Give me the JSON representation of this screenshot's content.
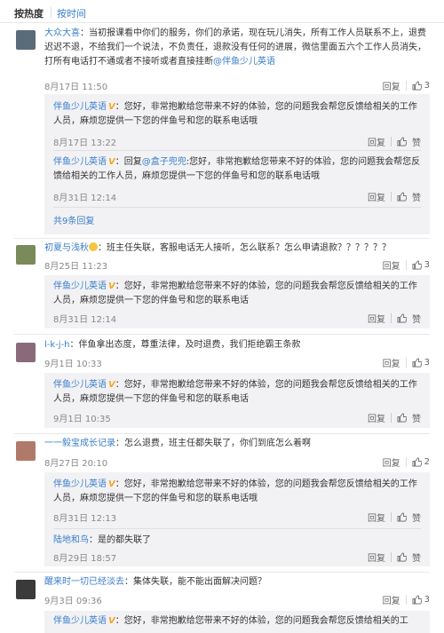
{
  "tabs": {
    "hot": "按热度",
    "time": "按时间"
  },
  "comments": [
    {
      "author": "大众大喜",
      "text": "：当初报课看中你们的服务，你们的承诺，现在玩儿消失，所有工作人员联系不上，退费迟迟不退，不给我们一个说法，不负责任，退款没有任何的进展，微信里面五六个工作人员消失，打所有电话打不通或者不接听或者直接挂断",
      "mention": "@伴鱼少儿英语",
      "time": "8月17日 11:50",
      "reply": "回复",
      "likes": "3",
      "avatar_color": "#5a6b7a",
      "replies": [
        {
          "author": "伴鱼少儿英语",
          "text": "：您好，非常抱歉给您带来不好的体验，您的问题我会帮您反馈给相关的工作人员，麻烦您提供一下您的伴鱼号和您的联系电话哦",
          "time": "8月17日 13:22",
          "reply": "回复",
          "like": "赞"
        },
        {
          "author": "伴鱼少儿英语",
          "prefix": "：回复",
          "mention": "@盒子兜兜",
          "text": ":您好，非常抱歉给您带来不好的体验，您的问题我会帮您反馈给相关的工作人员，麻烦您提供一下您的伴鱼号和您的联系电话哦",
          "time": "8月31日 12:14",
          "reply": "回复",
          "like": "赞"
        }
      ],
      "more": "共9条回复"
    },
    {
      "author": "初夏与浅秋",
      "text": "：班主任失联，客服电话无人接听，怎么联系？怎么申请退款？？？？？？",
      "time": "8月25日 11:23",
      "reply": "回复",
      "likes": "3",
      "avatar_color": "#7a8a5a",
      "replies": [
        {
          "author": "伴鱼少儿英语",
          "text": "：您好，非常抱歉给您带来不好的体验，您的问题我会帮您反馈给相关的工作人员，麻烦您提供一下您的伴鱼号和您的联系电话",
          "time": "8月31日 12:14",
          "reply": "回复",
          "like": "赞"
        }
      ]
    },
    {
      "author": "l-k-j-h",
      "text": "：伴鱼拿出态度，尊重法律，及时退费，我们拒绝霸王条款",
      "time": "9月1日 10:33",
      "reply": "回复",
      "likes": "3",
      "avatar_color": "#8a6a7a",
      "replies": [
        {
          "author": "伴鱼少儿英语",
          "text": "：您好，非常抱歉给您带来不好的体验，您的问题我会帮您反馈给相关的工作人员，麻烦您提供一下您的伴鱼号和您的联系电话",
          "time": "9月1日 10:35",
          "reply": "回复",
          "like": "赞"
        }
      ]
    },
    {
      "author": "一一毅宝成长记录",
      "text": "：怎么退费，班主任都失联了，你们到底怎么着啊",
      "time": "8月27日 20:10",
      "reply": "回复",
      "likes": "2",
      "avatar_color": "#b07a6a",
      "replies": [
        {
          "author": "伴鱼少儿英语",
          "text": "：您好，非常抱歉给您带来不好的体验，您的问题我会帮您反馈给相关的工作人员，麻烦您提供一下您的伴鱼号和您的联系电话哦",
          "time": "8月31日 12:13",
          "reply": "回复",
          "like": "赞"
        },
        {
          "author": "陆地和鸟",
          "text": "：是的都失联了",
          "time": "8月29日 18:57",
          "reply": "回复",
          "like": "赞"
        }
      ]
    },
    {
      "author": "醒来时一切已经淡去",
      "text": "：集体失联，能不能出面解决问题？",
      "time": "9月3日 09:36",
      "reply": "回复",
      "likes": "3",
      "avatar_color": "#3a3a3a",
      "replies": [
        {
          "author": "伴鱼少儿英语",
          "text": "：您好，非常抱歉给您带来不好的体验，您的问题我会帮您反馈给相关的工"
        }
      ]
    }
  ]
}
